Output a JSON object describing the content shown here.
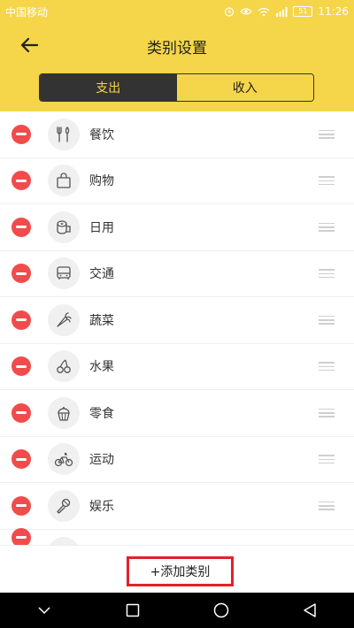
{
  "status_bar": {
    "carrier": "中国移动",
    "time": "11:26",
    "battery": "51"
  },
  "header": {
    "title": "类别设置",
    "tabs": [
      {
        "label": "支出",
        "active": true
      },
      {
        "label": "收入",
        "active": false
      }
    ]
  },
  "categories": [
    {
      "label": "餐饮",
      "icon": "utensils-icon"
    },
    {
      "label": "购物",
      "icon": "shopping-bag-icon"
    },
    {
      "label": "日用",
      "icon": "tissue-roll-icon"
    },
    {
      "label": "交通",
      "icon": "bus-icon"
    },
    {
      "label": "蔬菜",
      "icon": "carrot-icon"
    },
    {
      "label": "水果",
      "icon": "cherry-icon"
    },
    {
      "label": "零食",
      "icon": "cupcake-icon"
    },
    {
      "label": "运动",
      "icon": "bicycle-icon"
    },
    {
      "label": "娱乐",
      "icon": "microphone-icon"
    }
  ],
  "footer": {
    "add_label": "+添加类别"
  },
  "colors": {
    "accent": "#f5d54a",
    "remove": "#f24b4b",
    "highlight_border": "#e2202a"
  }
}
